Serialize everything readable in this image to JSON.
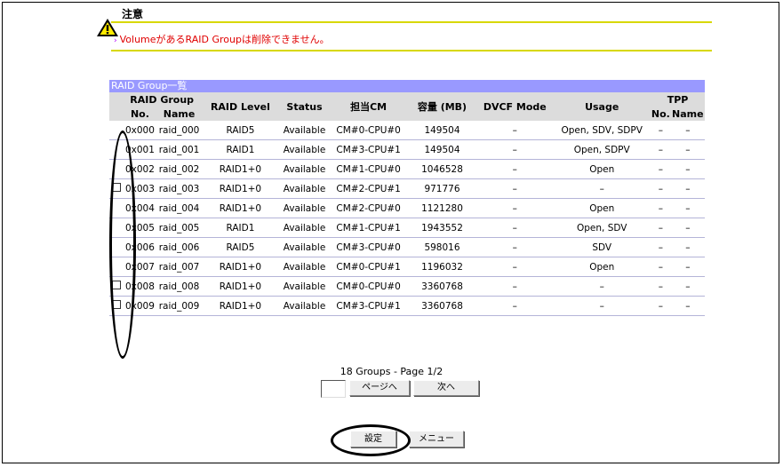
{
  "warning": {
    "title": "注意",
    "message": "VolumeがあるRAID Groupは削除できません。"
  },
  "table": {
    "title": "RAID Group一覧",
    "headers": {
      "raid_group": "RAID Group",
      "no": "No.",
      "name": "Name",
      "raid_level": "RAID Level",
      "status": "Status",
      "cm": "担当CM",
      "capacity": "容量 (MB)",
      "dvcf_mode": "DVCF Mode",
      "usage": "Usage",
      "tpp": "TPP",
      "tpp_no": "No.",
      "tpp_name": "Name"
    },
    "rows": [
      {
        "checkbox": false,
        "no": "0x000",
        "name": "raid_000",
        "level": "RAID5",
        "status": "Available",
        "cm": "CM#0-CPU#0",
        "capacity": "149504",
        "dvcf": "–",
        "usage": "Open, SDV, SDPV",
        "tpp_no": "–",
        "tpp_name": "–"
      },
      {
        "checkbox": false,
        "no": "0x001",
        "name": "raid_001",
        "level": "RAID1",
        "status": "Available",
        "cm": "CM#3-CPU#1",
        "capacity": "149504",
        "dvcf": "–",
        "usage": "Open, SDPV",
        "tpp_no": "–",
        "tpp_name": "–"
      },
      {
        "checkbox": false,
        "no": "0x002",
        "name": "raid_002",
        "level": "RAID1+0",
        "status": "Available",
        "cm": "CM#1-CPU#0",
        "capacity": "1046528",
        "dvcf": "–",
        "usage": "Open",
        "tpp_no": "–",
        "tpp_name": "–"
      },
      {
        "checkbox": true,
        "no": "0x003",
        "name": "raid_003",
        "level": "RAID1+0",
        "status": "Available",
        "cm": "CM#2-CPU#1",
        "capacity": "971776",
        "dvcf": "–",
        "usage": "–",
        "tpp_no": "–",
        "tpp_name": "–"
      },
      {
        "checkbox": false,
        "no": "0x004",
        "name": "raid_004",
        "level": "RAID1+0",
        "status": "Available",
        "cm": "CM#2-CPU#0",
        "capacity": "1121280",
        "dvcf": "–",
        "usage": "Open",
        "tpp_no": "–",
        "tpp_name": "–"
      },
      {
        "checkbox": false,
        "no": "0x005",
        "name": "raid_005",
        "level": "RAID1",
        "status": "Available",
        "cm": "CM#1-CPU#1",
        "capacity": "1943552",
        "dvcf": "–",
        "usage": "Open, SDV",
        "tpp_no": "–",
        "tpp_name": "–"
      },
      {
        "checkbox": false,
        "no": "0x006",
        "name": "raid_006",
        "level": "RAID5",
        "status": "Available",
        "cm": "CM#3-CPU#0",
        "capacity": "598016",
        "dvcf": "–",
        "usage": "SDV",
        "tpp_no": "–",
        "tpp_name": "–"
      },
      {
        "checkbox": false,
        "no": "0x007",
        "name": "raid_007",
        "level": "RAID1+0",
        "status": "Available",
        "cm": "CM#0-CPU#1",
        "capacity": "1196032",
        "dvcf": "–",
        "usage": "Open",
        "tpp_no": "–",
        "tpp_name": "–"
      },
      {
        "checkbox": true,
        "no": "0x008",
        "name": "raid_008",
        "level": "RAID1+0",
        "status": "Available",
        "cm": "CM#0-CPU#0",
        "capacity": "3360768",
        "dvcf": "–",
        "usage": "–",
        "tpp_no": "–",
        "tpp_name": "–"
      },
      {
        "checkbox": true,
        "no": "0x009",
        "name": "raid_009",
        "level": "RAID1+0",
        "status": "Available",
        "cm": "CM#3-CPU#1",
        "capacity": "3360768",
        "dvcf": "–",
        "usage": "–",
        "tpp_no": "–",
        "tpp_name": "–"
      }
    ]
  },
  "pagination": {
    "summary": "18 Groups - Page 1/2",
    "goto_label": "ページへ",
    "next_label": "次へ",
    "page_input_value": ""
  },
  "actions": {
    "set_label": "設定",
    "menu_label": "メニュー"
  },
  "colors": {
    "table_header_bg": "#9999ff",
    "warning_text": "#e00000",
    "rule_color": "#d8d800"
  }
}
